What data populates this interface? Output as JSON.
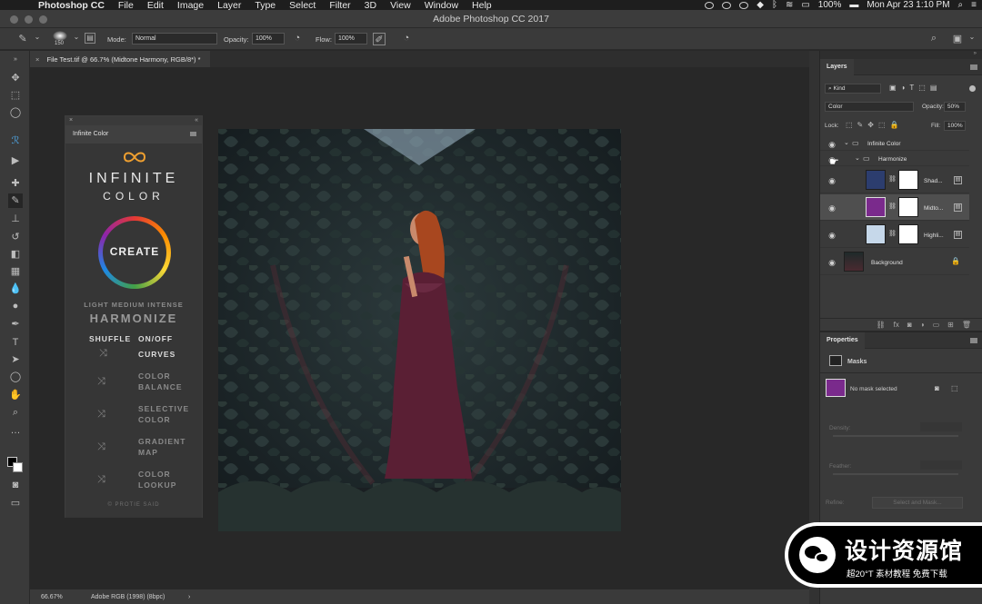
{
  "menubar": {
    "app_name": "Photoshop CC",
    "items": [
      "File",
      "Edit",
      "Image",
      "Layer",
      "Type",
      "Select",
      "Filter",
      "3D",
      "View",
      "Window",
      "Help"
    ],
    "battery": "100%",
    "clock": "Mon Apr 23  1:10 PM"
  },
  "window": {
    "title": "Adobe Photoshop CC 2017"
  },
  "options": {
    "brush_size": "150",
    "mode_label": "Mode:",
    "mode_value": "Normal",
    "opacity_label": "Opacity:",
    "opacity_value": "100%",
    "flow_label": "Flow:",
    "flow_value": "100%"
  },
  "document": {
    "tab_label": "File Test.tif @ 66.7% (Midtone Harmony, RGB/8*) *"
  },
  "infinite_color": {
    "panel_tab": "Infinite Color",
    "logo_line1": "INFINITE",
    "logo_line2": "COLOR",
    "create": "CREATE",
    "levels": "LIGHT MEDIUM INTENSE",
    "harmonize": "HARMONIZE",
    "shuffle": "SHUFFLE",
    "onoff": "ON/OFF",
    "rows": [
      {
        "label": "CURVES"
      },
      {
        "label": "COLOR BALANCE"
      },
      {
        "label": "SELECTIVE COLOR"
      },
      {
        "label": "GRADIENT MAP"
      },
      {
        "label": "COLOR LOOKUP"
      }
    ],
    "footer": "© PROTIE SAID"
  },
  "layers_panel": {
    "tab": "Layers",
    "filter_kind": "Kind",
    "blend_mode": "Color",
    "opacity_label": "Opacity:",
    "opacity_value": "50%",
    "lock_label": "Lock:",
    "fill_label": "Fill:",
    "fill_value": "100%",
    "layers": [
      {
        "name": "Infinite Color",
        "type": "group"
      },
      {
        "name": "Harmonize",
        "type": "group"
      },
      {
        "name": "Shad...",
        "type": "adjustment",
        "color": "#2c3d6e"
      },
      {
        "name": "Midto...",
        "type": "adjustment",
        "color": "#7a2a8c"
      },
      {
        "name": "Highli...",
        "type": "adjustment",
        "color": "#c6d8ea"
      },
      {
        "name": "Background",
        "type": "image"
      }
    ]
  },
  "properties_panel": {
    "tab": "Properties",
    "section": "Masks",
    "status": "No mask selected",
    "density_label": "Density:",
    "feather_label": "Feather:",
    "refine_label": "Refine:",
    "select_mask_button": "Select and Mask...",
    "swatch_color": "#7a2a8c"
  },
  "statusbar": {
    "zoom": "66.67%",
    "profile": "Adobe RGB (1998) (8bpc)"
  },
  "watermark": {
    "title": "设计资源馆",
    "subtitle": "超20°T 素材教程 免费下载"
  }
}
